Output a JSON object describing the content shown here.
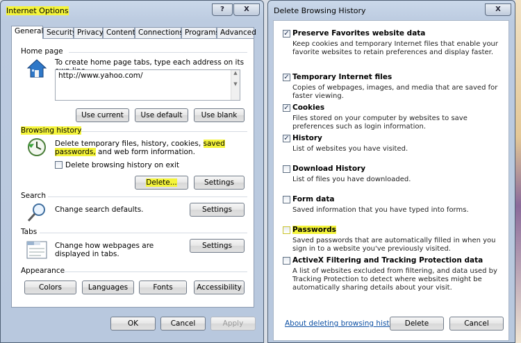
{
  "internet_options": {
    "title": "Internet Options",
    "help_label": "?",
    "close_label": "X",
    "tabs": [
      "General",
      "Security",
      "Privacy",
      "Content",
      "Connections",
      "Programs",
      "Advanced"
    ],
    "home_page": {
      "label": "Home page",
      "desc": "To create home page tabs, type each address on its own line.",
      "value": "http://www.yahoo.com/",
      "buttons": [
        "Use current",
        "Use default",
        "Use blank"
      ]
    },
    "browsing_history": {
      "label": "Browsing history",
      "desc_pre": "Delete temporary files, history, cookies, ",
      "desc_hl": "saved passwords,",
      "desc_post": "and web form information.",
      "checkbox_label": "Delete browsing history on exit",
      "delete_label": "Delete...",
      "settings_label": "Settings"
    },
    "search": {
      "label": "Search",
      "desc": "Change search defaults.",
      "settings_label": "Settings"
    },
    "tabs_group": {
      "label": "Tabs",
      "desc": "Change how webpages are displayed in tabs.",
      "settings_label": "Settings"
    },
    "appearance": {
      "label": "Appearance",
      "buttons": [
        "Colors",
        "Languages",
        "Fonts",
        "Accessibility"
      ]
    },
    "footer": {
      "ok": "OK",
      "cancel": "Cancel",
      "apply": "Apply"
    }
  },
  "delete_history": {
    "title": "Delete Browsing History",
    "close_label": "X",
    "options": [
      {
        "title": "Preserve Favorites website data",
        "checked": true,
        "desc": "Keep cookies and temporary Internet files that enable your favorite websites to retain preferences and display faster."
      },
      {
        "title": "Temporary Internet files",
        "checked": true,
        "desc": "Copies of webpages, images, and media that are saved for faster viewing."
      },
      {
        "title": "Cookies",
        "checked": true,
        "desc": "Files stored on your computer by websites to save preferences such as login information."
      },
      {
        "title": "History",
        "checked": true,
        "desc": "List of websites you have visited."
      },
      {
        "title": "Download History",
        "checked": false,
        "desc": "List of files you have downloaded."
      },
      {
        "title": "Form data",
        "checked": false,
        "desc": "Saved information that you have typed into forms."
      },
      {
        "title": "Passwords",
        "checked": false,
        "desc": "Saved passwords that are automatically filled in when you sign in to a website you've previously visited."
      },
      {
        "title": "ActiveX Filtering and Tracking Protection data",
        "checked": false,
        "desc": "A list of websites excluded from filtering, and data used by Tracking Protection to detect where websites might be automatically sharing details about your visit."
      }
    ],
    "link": "About deleting browsing history",
    "delete_label": "Delete",
    "cancel_label": "Cancel"
  },
  "colors": {
    "highlight": "#f4f43a",
    "link": "#0c4fa3",
    "titlebar": "#bccbe0"
  }
}
